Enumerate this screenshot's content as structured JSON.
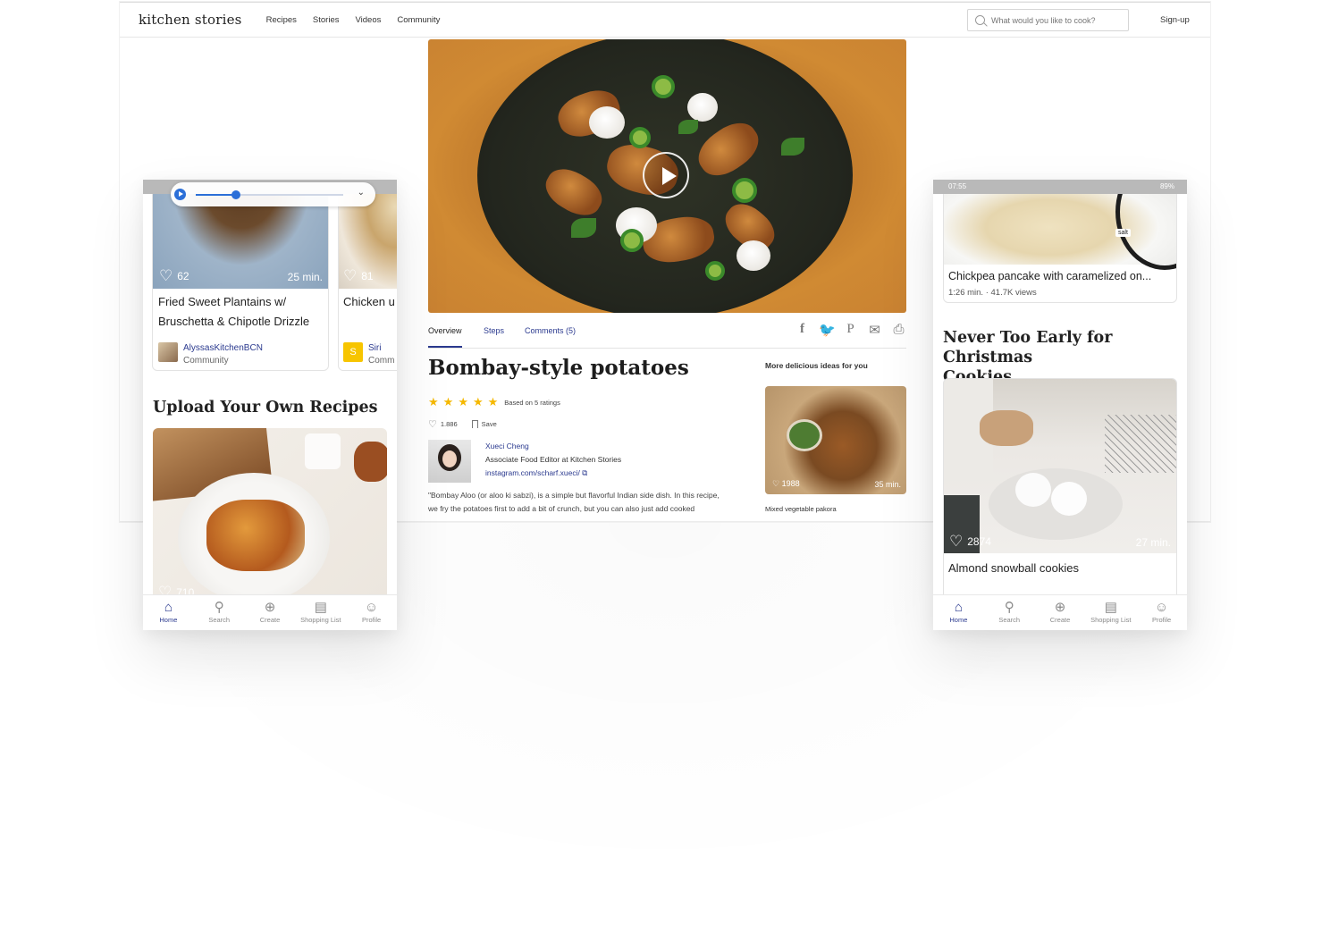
{
  "desktop": {
    "logo": "kitchen stories",
    "nav": [
      "Recipes",
      "Stories",
      "Videos",
      "Community"
    ],
    "search_placeholder": "What would you like to cook?",
    "signup": "Sign-up",
    "tabs": [
      "Overview",
      "Steps",
      "Comments (5)"
    ],
    "share_icons": [
      "facebook-icon",
      "twitter-icon",
      "pinterest-icon",
      "mail-icon",
      "print-icon"
    ],
    "recipe": {
      "title": "Bombay-style potatoes",
      "rating_text": "Based on 5 ratings",
      "stars": 5,
      "likes": "1.886",
      "save": "Save",
      "author_name": "Xueci Cheng",
      "author_role": "Associate Food Editor at Kitchen Stories",
      "author_instagram": "instagram.com/scharf.xueci/",
      "description_line1": "\"Bombay Aloo (or aloo ki sabzi), is a simple but flavorful Indian side dish. In this recipe,",
      "description_line2": "we fry the potatoes first to add a bit of crunch, but you can also just add cooked"
    },
    "more_title": "More delicious ideas for you",
    "more_card": {
      "likes": "1988",
      "time": "35 min.",
      "name": "Mixed vegetable pakora"
    }
  },
  "phone_left": {
    "card1": {
      "likes": "62",
      "time": "25 min.",
      "title_line1": "Fried Sweet Plantains w/",
      "title_line2": "Bruschetta & Chipotle Drizzle",
      "author": "AlyssasKitchenBCN",
      "community": "Community"
    },
    "card2": {
      "likes": "81",
      "title": "Chicken u",
      "author": "Siri",
      "community": "Comm",
      "avatar_letter": "S"
    },
    "section_title": "Upload Your Own Recipes",
    "big_likes": "710",
    "media_progress": 0.27
  },
  "phone_right": {
    "status_time": "07:55",
    "status_battery": "89%",
    "video": {
      "title": "Chickpea pancake with caramelized on...",
      "meta": "1:26 min. · 41.7K views",
      "label": "salt"
    },
    "section_title_line1": "Never Too Early for Christmas",
    "section_title_line2": "Cookies",
    "card": {
      "likes": "2874",
      "time": "27 min.",
      "title": "Almond snowball cookies"
    }
  },
  "bottom_nav": [
    "Home",
    "Search",
    "Create",
    "Shopping List",
    "Profile"
  ]
}
